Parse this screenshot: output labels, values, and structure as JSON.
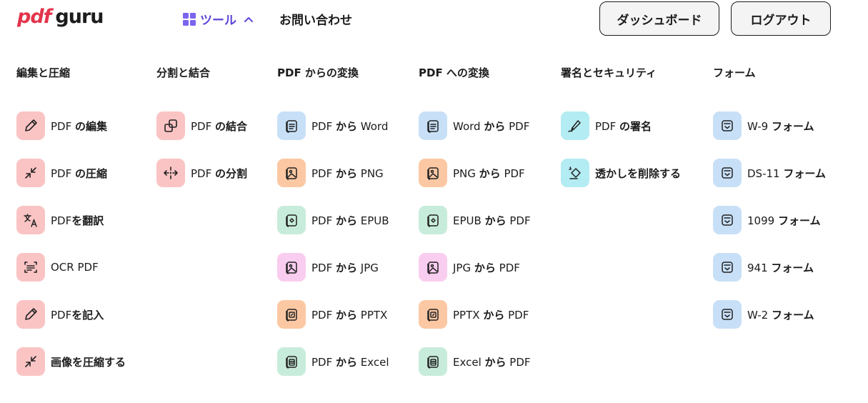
{
  "header": {
    "logo_pdf": "pdf",
    "logo_guru": "guru",
    "tools_label": "ツール",
    "contact_label": "お問い合わせ",
    "dashboard_label": "ダッシュボード",
    "logout_label": "ログアウト",
    "accent_color": "#5b45d9",
    "logo_color": "#e3344b"
  },
  "columns": [
    {
      "title": "編集と圧縮",
      "items": [
        {
          "icon": "pencil-icon",
          "a": "PDF ",
          "b": "の編集"
        },
        {
          "icon": "compress-icon",
          "a": "PDF ",
          "b": "の圧縮"
        },
        {
          "icon": "translate-icon",
          "a": "PDF",
          "b": "を翻訳"
        },
        {
          "icon": "scan-icon",
          "a": "OCR PDF",
          "b": ""
        },
        {
          "icon": "pencil-icon",
          "a": "PDF",
          "b": "を記入"
        },
        {
          "icon": "compress-icon",
          "a": "",
          "b": "画像を圧縮する"
        }
      ]
    },
    {
      "title": "分割と結合",
      "items": [
        {
          "icon": "merge-icon",
          "a": "PDF ",
          "b": "の結合"
        },
        {
          "icon": "split-icon",
          "a": "PDF ",
          "b": "の分割"
        }
      ]
    },
    {
      "title": "PDF からの変換",
      "items": [
        {
          "icon": "document-icon",
          "a": "PDF ",
          "b": "から",
          "c": " Word"
        },
        {
          "icon": "image-icon",
          "a": "PDF ",
          "b": "から",
          "c": " PNG"
        },
        {
          "icon": "epub-icon",
          "a": "PDF ",
          "b": "から",
          "c": " EPUB"
        },
        {
          "icon": "image-icon",
          "a": "PDF ",
          "b": "から",
          "c": " JPG"
        },
        {
          "icon": "slides-icon",
          "a": "PDF ",
          "b": "から",
          "c": " PPTX"
        },
        {
          "icon": "spreadsheet-icon",
          "a": "PDF ",
          "b": "から",
          "c": " Excel"
        }
      ]
    },
    {
      "title": "PDF への変換",
      "items": [
        {
          "icon": "document-icon",
          "a": "Word ",
          "b": "から",
          "c": " PDF"
        },
        {
          "icon": "image-icon",
          "a": "PNG ",
          "b": "から",
          "c": " PDF"
        },
        {
          "icon": "epub-icon",
          "a": "EPUB ",
          "b": "から",
          "c": " PDF"
        },
        {
          "icon": "image-icon",
          "a": "JPG ",
          "b": "から",
          "c": " PDF"
        },
        {
          "icon": "slides-icon",
          "a": "PPTX ",
          "b": "から",
          "c": " PDF"
        },
        {
          "icon": "spreadsheet-icon",
          "a": "Excel ",
          "b": "から",
          "c": " PDF"
        }
      ]
    },
    {
      "title": "署名とセキュリティ",
      "items": [
        {
          "icon": "signature-pen-icon",
          "a": "PDF ",
          "b": "の署名"
        },
        {
          "icon": "eraser-icon",
          "a": "",
          "b": "透かしを削除する"
        }
      ]
    },
    {
      "title": "フォーム",
      "items": [
        {
          "icon": "form-icon",
          "a": "W-9 ",
          "b": "フォーム"
        },
        {
          "icon": "form-icon",
          "a": "DS-11 ",
          "b": "フォーム"
        },
        {
          "icon": "form-icon",
          "a": "1099 ",
          "b": "フォーム"
        },
        {
          "icon": "form-icon",
          "a": "941 ",
          "b": "フォーム"
        },
        {
          "icon": "form-icon",
          "a": "W-2 ",
          "b": "フォーム"
        }
      ]
    }
  ],
  "icon_colors": {
    "pink": "#fbc4c4",
    "blue": "#c8e0f7",
    "orange": "#fcc8a3",
    "green": "#c8ecdb",
    "magenta": "#f9cdef",
    "cyan": "#b3ecf2"
  }
}
